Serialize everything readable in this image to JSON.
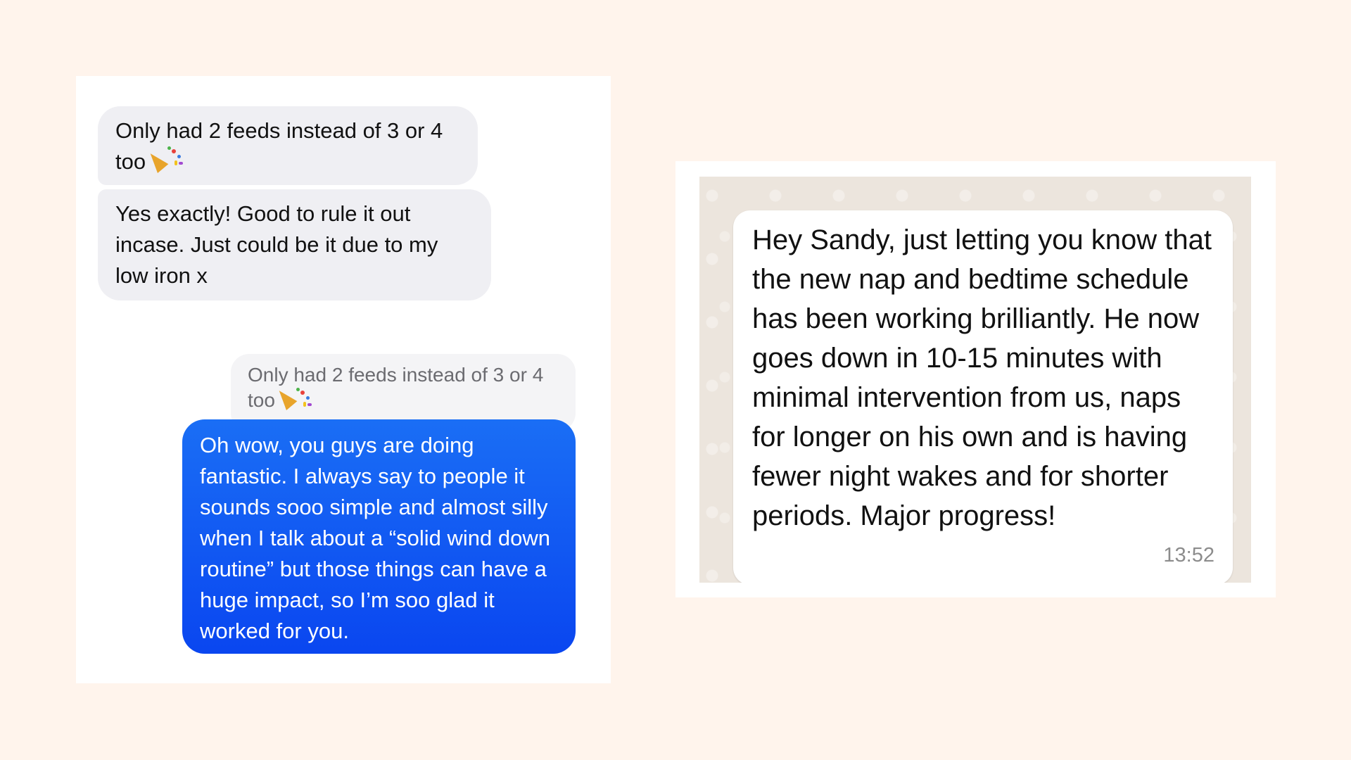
{
  "left_chat": {
    "messages_in": [
      {
        "text": "Only had 2 feeds instead of 3 or 4 too",
        "emoji": "party-popper"
      },
      {
        "text": "Yes exactly! Good to rule it out incase. Just could be it due to my low iron x"
      }
    ],
    "reply_quote": {
      "text": "Only had 2 feeds instead of 3 or 4 too",
      "emoji": "party-popper"
    },
    "message_out": {
      "text": "Oh wow, you guys are doing fantastic. I always say to people it sounds sooo simple and almost silly when I talk about a “solid wind down routine” but those things can have a huge impact, so I’m soo glad it worked for you."
    },
    "colors": {
      "incoming_bubble": "#efeff3",
      "outgoing_bubble": "#1a6ef5"
    }
  },
  "right_chat": {
    "message": {
      "text": "Hey Sandy, just letting you know that the new nap and bedtime schedule has been working brilliantly. He now goes down in 10-15 minutes with minimal intervention from us, naps for longer on his own and is having fewer night wakes and for shorter periods. Major progress!",
      "time": "13:52"
    },
    "colors": {
      "chat_background": "#ece5dd",
      "bubble": "#ffffff"
    }
  }
}
